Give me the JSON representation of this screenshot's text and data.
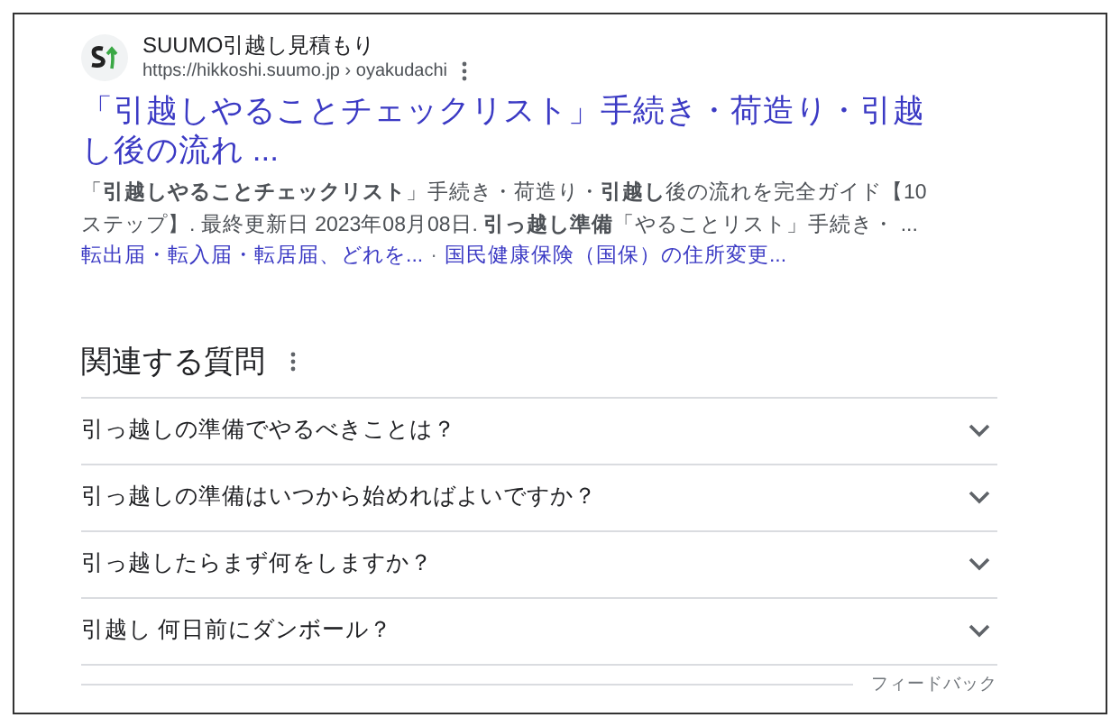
{
  "result": {
    "site_name": "SUUMO引越し見積もり",
    "url": "https://hikkoshi.suumo.jp › oyakudachi",
    "title": "「引越しやることチェックリスト」手続き・荷造り・引越し後の流れ ...",
    "snippet": "「**引越しやることチェックリスト**」手続き・荷造り・**引越し**後の流れを完全ガイド【10ステップ】. 最終更新日 2023年08月08日. **引っ越し準備**「やることリスト」手続き・ ...",
    "sitelinks": [
      "転出届・転入届・転居届、どれを...",
      "国民健康保険（国保）の住所変更..."
    ],
    "sitelink_separator": "·"
  },
  "related_questions": {
    "heading": "関連する質問",
    "questions": [
      {
        "text": "引っ越しの準備でやるべきことは？",
        "expanded": false
      },
      {
        "text": "引っ越しの準備はいつから始めればよいですか？",
        "expanded": false
      },
      {
        "text": "引っ越したらまず何をしますか？",
        "expanded": false
      },
      {
        "text": "引越し 何日前にダンボール？",
        "expanded": false
      }
    ],
    "feedback": "フィードバック"
  }
}
